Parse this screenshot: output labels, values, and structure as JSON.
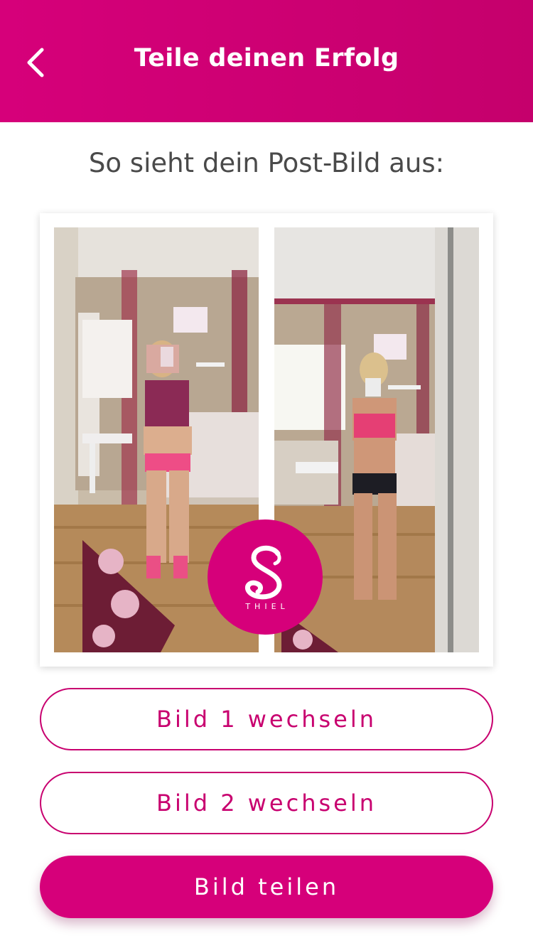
{
  "header": {
    "title": "Teile deinen Erfolg",
    "back_icon": "chevron-left-icon"
  },
  "main": {
    "subtitle": "So sieht dein Post-Bild aus:",
    "post_image": {
      "photo_1": "before-photo",
      "photo_2": "after-photo",
      "brand_letter": "S",
      "brand_name": "THIEL"
    }
  },
  "buttons": {
    "change_image_1": "Bild 1 wechseln",
    "change_image_2": "Bild 2 wechseln",
    "share_image": "Bild teilen"
  },
  "colors": {
    "accent": "#d6007a",
    "header_end": "#c5006c",
    "text_dark": "#4a4a4a",
    "white": "#ffffff"
  }
}
